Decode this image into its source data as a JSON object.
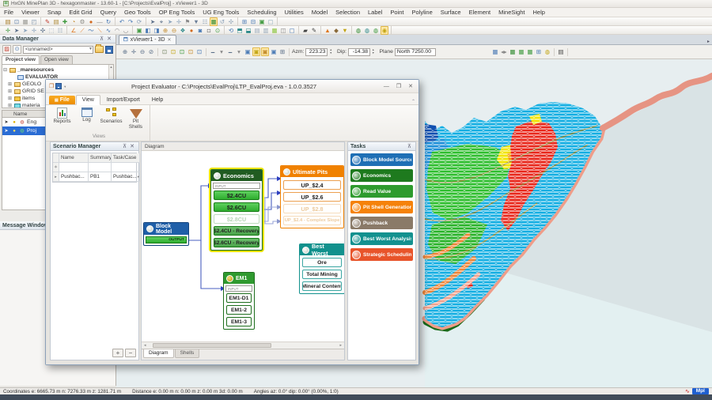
{
  "palette": {
    "accent_blue": "#1f5fa8",
    "accent_green": "#2f9a2f",
    "accent_dark_green": "#215c21",
    "accent_orange": "#f08100",
    "accent_teal": "#12918d",
    "accent_red": "#e8542a",
    "selection_yellow": "#ece400",
    "terrain_cyan": "#14aee2",
    "terrain_red": "#e8281c",
    "terrain_green": "#2fbe2f",
    "ridge_salmon": "#e69483"
  },
  "titlebar": {
    "title": "HxGN MinePlan 3D - hexagonmaster - 13.60-1 - [C:\\Projects\\EvalProj] - xViewer1 - 3D"
  },
  "menu": {
    "items": [
      "File",
      "Viewer",
      "Snap",
      "Edit Grid",
      "Query",
      "Geo Tools",
      "OP Eng Tools",
      "UG Eng Tools",
      "Scheduling",
      "Utilities",
      "Model",
      "Selection",
      "Label",
      "Point",
      "Polyline",
      "Surface",
      "Element",
      "MineSight",
      "Help"
    ]
  },
  "toolbars": {
    "row1": [
      [
        {
          "g": "▤",
          "c": "#a77b28",
          "n": "panel-icon"
        },
        {
          "g": "⊡",
          "c": "#6d8bb0",
          "n": "copy-view-icon"
        },
        {
          "g": "▦",
          "c": "#9a9a94",
          "n": "grid-icon"
        },
        {
          "g": "◰",
          "c": "#7d94ab",
          "n": "layout-icon"
        }
      ],
      [
        {
          "g": "✎",
          "c": "#c03a2c",
          "n": "edit-icon"
        },
        {
          "g": "▤",
          "c": "#b08c3a",
          "n": "notes-icon"
        },
        {
          "g": "✚",
          "c": "#3f9a3f",
          "n": "add-icon"
        },
        {
          "g": "◔",
          "c": "#c28a2a",
          "n": "clock-icon"
        },
        {
          "g": "⚙",
          "c": "#8a8a84",
          "n": "settings-icon"
        },
        {
          "g": "●",
          "c": "#d2691e",
          "n": "point-icon"
        },
        {
          "g": "—",
          "c": "#888888",
          "n": "line-icon"
        },
        {
          "g": "↻",
          "c": "#4a7ab5",
          "n": "refresh-icon"
        }
      ],
      [
        {
          "g": "↶",
          "c": "#4a7ab5",
          "n": "undo-icon"
        },
        {
          "g": "↷",
          "c": "#4a7ab5",
          "n": "redo-icon"
        },
        {
          "g": "⟳",
          "c": "#8aa0b8",
          "n": "reload-icon"
        }
      ],
      [
        {
          "g": "➤",
          "c": "#5a6e88",
          "n": "select-icon"
        },
        {
          "g": "⌖",
          "c": "#5a6e88",
          "n": "target-icon"
        },
        {
          "g": "➤",
          "c": "#8ca4bc",
          "n": "select-element-icon"
        },
        {
          "g": "✛",
          "c": "#8ca4bc",
          "n": "move-icon"
        },
        {
          "g": "⚑",
          "c": "#888888",
          "n": "flag-icon"
        },
        {
          "g": "▼",
          "c": "#6a7e98",
          "n": "filter-icon"
        },
        {
          "g": "☷",
          "c": "#99aabb",
          "n": "layers-icon"
        },
        {
          "g": "▦",
          "c": "#2f8a2f",
          "hl": true,
          "n": "snap-grid-icon"
        },
        {
          "g": "↺",
          "c": "#8aa0b8",
          "n": "rotate-icon"
        },
        {
          "g": "✣",
          "c": "#99aabb",
          "n": "scatter-icon"
        }
      ],
      [
        {
          "g": "⊞",
          "c": "#4a7ab5",
          "n": "new-window-icon"
        },
        {
          "g": "⊟",
          "c": "#4a7ab5",
          "n": "split-window-icon"
        },
        {
          "g": "▣",
          "c": "#3f9a3f",
          "n": "viewport-icon"
        },
        {
          "g": "▢",
          "c": "#88aabb",
          "n": "frame-icon"
        }
      ]
    ],
    "row2": [
      [
        {
          "g": "✛",
          "c": "#3f9a3f",
          "n": "move-point-icon"
        },
        {
          "g": "➤",
          "c": "#5a6e88",
          "n": "pick-icon"
        },
        {
          "g": "➤",
          "c": "#8ca4bc",
          "n": "pick-add-icon"
        },
        {
          "g": "✛",
          "c": "#8ca4bc",
          "n": "translate-icon"
        },
        {
          "g": "✣",
          "c": "#5a6e88",
          "n": "multi-select-icon"
        },
        {
          "g": "⬚",
          "c": "#99aabb",
          "n": "marquee-icon"
        },
        {
          "g": "☷",
          "c": "#99aabb",
          "n": "list-icon"
        }
      ],
      [
        {
          "g": "∠",
          "c": "#e07820",
          "n": "angle-icon"
        },
        {
          "g": "⟋",
          "c": "#e07820",
          "n": "segment-icon"
        },
        {
          "g": "〜",
          "c": "#4a7ab5",
          "n": "curve-icon"
        },
        {
          "g": "⟍",
          "c": "#e07820",
          "n": "slope-icon"
        },
        {
          "g": "∿",
          "c": "#4a7ab5",
          "n": "spline-icon"
        },
        {
          "g": "◠",
          "c": "#888888",
          "n": "arc-icon"
        },
        {
          "g": "◡",
          "c": "#888888",
          "n": "arc2-icon"
        }
      ],
      [
        {
          "g": "▣",
          "c": "#3f9a3f",
          "n": "cube-icon"
        },
        {
          "g": "◧",
          "c": "#4a7ab5",
          "n": "half-block-icon"
        },
        {
          "g": "◨",
          "c": "#4a7ab5",
          "n": "half-block2-icon"
        },
        {
          "g": "⊕",
          "c": "#c28a2a",
          "n": "add-node-icon"
        },
        {
          "g": "⊖",
          "c": "#c28a2a",
          "n": "remove-node-icon"
        },
        {
          "g": "❖",
          "c": "#2f8a8a",
          "n": "diamond-icon"
        },
        {
          "g": "●",
          "c": "#d2691e",
          "n": "sphere-icon"
        },
        {
          "g": "◙",
          "c": "#4a7ab5",
          "n": "solid-icon"
        },
        {
          "g": "◘",
          "c": "#888888",
          "n": "void-icon"
        },
        {
          "g": "⊙",
          "c": "#3f9a3f",
          "n": "ring-icon"
        }
      ],
      [
        {
          "g": "⟲",
          "c": "#4a7ab5",
          "n": "undo-geom-icon"
        },
        {
          "g": "⬒",
          "c": "#2f8a8a",
          "n": "surface-top-icon"
        },
        {
          "g": "⬓",
          "c": "#2f8a8a",
          "n": "surface-bottom-icon"
        },
        {
          "g": "▤",
          "c": "#99aabb",
          "n": "stack-icon"
        },
        {
          "g": "▥",
          "c": "#99aabb",
          "n": "columns-icon"
        },
        {
          "g": "▦",
          "c": "#8cc63f",
          "n": "mesh-icon"
        },
        {
          "g": "◫",
          "c": "#888888",
          "n": "pair-icon"
        },
        {
          "g": "▢",
          "c": "#4a7ab5",
          "n": "outline-icon"
        }
      ],
      [
        {
          "g": "▰",
          "c": "#444444",
          "n": "fill-icon"
        },
        {
          "g": "✎",
          "c": "#444444",
          "n": "annotate-icon"
        }
      ],
      [
        {
          "g": "▲",
          "c": "#e07820",
          "n": "triangle-icon"
        },
        {
          "g": "◆",
          "c": "#8a6a3a",
          "n": "rhombus-icon"
        },
        {
          "g": "▼",
          "c": "#c2a514",
          "n": "funnel-icon"
        }
      ],
      [
        {
          "g": "◍",
          "c": "#2f8a2f",
          "n": "globe-icon"
        },
        {
          "g": "◍",
          "c": "#2f8a8a",
          "n": "globe2-icon"
        },
        {
          "g": "◍",
          "c": "#3f9a3f",
          "n": "globe3-icon"
        },
        {
          "g": "◉",
          "c": "#c2a514",
          "hl": true,
          "n": "highlight-globe-icon"
        }
      ]
    ],
    "viewer_left": [
      [
        {
          "g": "⊕",
          "c": "#5a6e88",
          "n": "zoom-in-icon"
        },
        {
          "g": "✛",
          "c": "#5a6e88",
          "n": "pan-icon"
        },
        {
          "g": "⊖",
          "c": "#5a6e88",
          "n": "zoom-out-icon"
        },
        {
          "g": "⊘",
          "c": "#5a6e88",
          "n": "zoom-reset-icon"
        }
      ],
      [
        {
          "g": "⊡",
          "c": "#7a8a6a",
          "n": "clipboard-icon"
        },
        {
          "g": "⊡",
          "c": "#c2a514",
          "n": "clipboard-new-icon"
        },
        {
          "g": "⊡",
          "c": "#3f9a3f",
          "n": "clipboard-open-icon"
        },
        {
          "g": "⊡",
          "c": "#c28a2a",
          "n": "clipboard-save-icon"
        },
        {
          "g": "⊡",
          "c": "#4a7ab5",
          "n": "clipboard-view-icon"
        }
      ],
      [
        {
          "g": "🗕",
          "c": "#5a6e88",
          "n": "monitor-icon"
        },
        {
          "g": "▾",
          "c": "#888888",
          "n": "dropdown-icon"
        },
        {
          "g": "🗕",
          "c": "#5a6e88",
          "n": "monitor2-icon"
        },
        {
          "g": "▾",
          "c": "#888888",
          "n": "dropdown2-icon"
        },
        {
          "g": "▣",
          "c": "#4a7ab5",
          "n": "view-cube-icon"
        },
        {
          "g": "▣",
          "c": "#c2a514",
          "hl": true,
          "n": "plane-lock-icon"
        },
        {
          "g": "▣",
          "c": "#c28a2a",
          "hl": true,
          "n": "grid-lock-icon"
        },
        {
          "g": "▣",
          "c": "#4a7ab5",
          "n": "view-mode-icon"
        },
        {
          "g": "⊞",
          "c": "#5a6e88",
          "n": "tile-icon"
        }
      ]
    ],
    "viewer_right": [
      [
        {
          "g": "▦",
          "c": "#4a7ab5",
          "n": "model-grid-icon"
        },
        {
          "g": "◂▸",
          "c": "#888888",
          "n": "step-icon"
        },
        {
          "g": "▦",
          "c": "#2f8a2f",
          "n": "green-grid-icon"
        },
        {
          "g": "▦",
          "c": "#3f9a3f",
          "n": "green-grid2-icon"
        },
        {
          "g": "▦",
          "c": "#3f9a3f",
          "n": "green-grid3-icon"
        },
        {
          "g": "⊞",
          "c": "#4a7ab5",
          "n": "blue-grid-icon"
        },
        {
          "g": "◍",
          "c": "#c2a514",
          "n": "globe-yellow-icon"
        }
      ],
      [
        {
          "g": "▤",
          "c": "#444444",
          "n": "print-icon"
        }
      ]
    ]
  },
  "data_manager": {
    "title": "Data Manager",
    "combo": "<unnamed>",
    "tabs": [
      "Project view",
      "Open view"
    ],
    "tree": [
      "_maresources",
      "EVALUATOR",
      "GEOLO",
      "GRID SE",
      "items",
      "materia"
    ],
    "items_header": "Name",
    "items": [
      {
        "name": "Eng"
      },
      {
        "name": "Proj"
      }
    ],
    "message_window_title": "Message Window"
  },
  "viewer": {
    "tab": "xViewer1 - 3D",
    "azm_label": "Azm:",
    "azm": "223.23",
    "dip_label": "Dip:",
    "dip": "-14.38",
    "plane_label": "Plane",
    "plane": "North 7250.00"
  },
  "evaluator": {
    "title": "Project Evaluator - C:\\Projects\\EvalProj\\LTP_EvalProj.eva - 1.0.0.3527",
    "tabs": {
      "file": "File",
      "view": "View",
      "import_export": "Import/Export",
      "help": "Help"
    },
    "ribbon": {
      "reports": "Reports",
      "log": "Log",
      "scenarios": "Scenarios",
      "pit_shells": "Pit\nShells",
      "group": "Views"
    },
    "scenario_manager": {
      "title": "Scenario Manager",
      "columns": [
        "Name",
        "Summary",
        "Task/Case"
      ],
      "row": {
        "name": "Pushbac...",
        "summary": "PB1",
        "task": "Pushbac..."
      },
      "add_label": "+",
      "remove_label": "−"
    },
    "diagram": {
      "title": "Diagram",
      "tabs": [
        "Diagram",
        "Shells"
      ],
      "nodes": {
        "block_model": {
          "title": "Block Model",
          "port": "OUTPUT"
        },
        "economics": {
          "title": "Economics",
          "input_label": "INPUT",
          "items": [
            {
              "label": "$2.4CU"
            },
            {
              "label": "$2.6CU"
            },
            {
              "label": "$2.8CU"
            },
            {
              "label": "$2.4CU - Recovery"
            },
            {
              "label": "$2.6CU - Recovery"
            }
          ]
        },
        "ultimate_pits": {
          "title": "Ultimate Pits",
          "items": [
            {
              "label": "UP_$2.4"
            },
            {
              "label": "UP_$2.6"
            },
            {
              "label": "UP_$2.8"
            },
            {
              "label": "UP_$2.4 - Complex Slope"
            }
          ]
        },
        "best_worst": {
          "title": "Best Worst",
          "items": [
            {
              "label": "Ore"
            },
            {
              "label": "Total Mining"
            },
            {
              "label": "Mineral Content"
            }
          ]
        },
        "em1": {
          "title": "EM1",
          "input_label": "INPUT",
          "items": [
            {
              "label": "EM1-D1"
            },
            {
              "label": "EM1-2"
            },
            {
              "label": "EM1-3"
            }
          ]
        }
      }
    },
    "tasks": {
      "title": "Tasks",
      "items": [
        {
          "label": "Block Model Source",
          "color": "#1f6fb5"
        },
        {
          "label": "Economics",
          "color": "#1e7a1e"
        },
        {
          "label": "Read Value",
          "color": "#2e9b2e"
        },
        {
          "label": "Pit Shell Generation",
          "color": "#f5820a"
        },
        {
          "label": "Pushback",
          "color": "#8a7a68"
        },
        {
          "label": "Best Worst Analysis",
          "color": "#13918f"
        },
        {
          "label": "Strategic Scheduling",
          "color": "#e8542a"
        }
      ]
    }
  },
  "status_bar": {
    "coordinates": "Coordinates   e: 6665.73 m   n: 7276.33 m   z: 1281.71 m",
    "distance": "Distance   e: 0.00 m   n: 0.00 m   z: 0.00 m   3d: 0.00 m",
    "angles": "Angles   az: 0.0°   dip: 0.00° (0.00%, 1:0)",
    "badge": "Mpl"
  }
}
